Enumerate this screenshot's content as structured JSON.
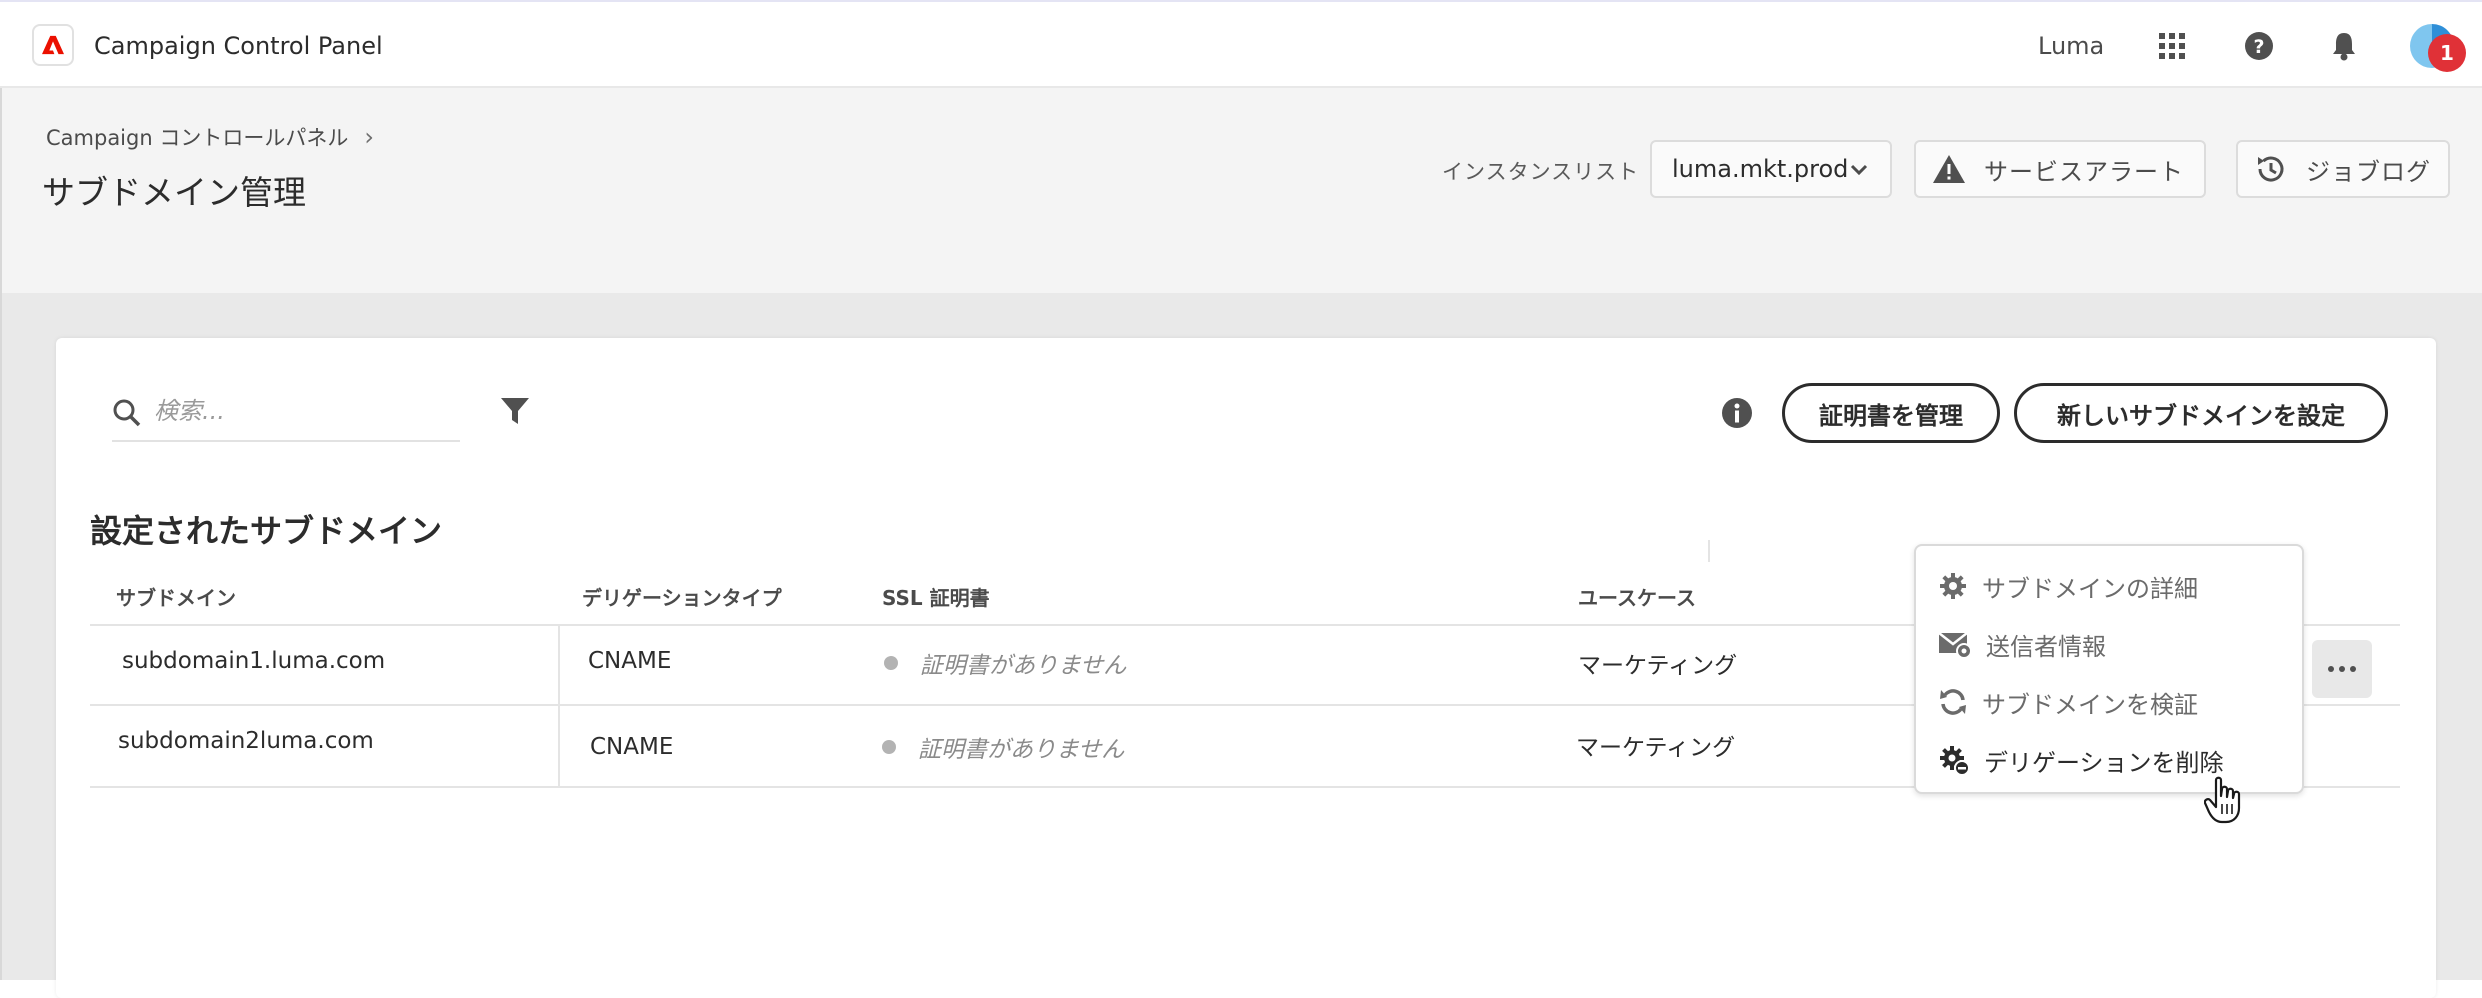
{
  "shell": {
    "app_title": "Campaign Control Panel",
    "org_name": "Luma",
    "icons": [
      "adobe-logo-icon",
      "apps-grid-icon",
      "help-icon",
      "bell-icon",
      "avatar"
    ]
  },
  "header": {
    "breadcrumb": "Campaign コントロールパネル",
    "title": "サブドメイン管理",
    "instance_label": "インスタンスリスト",
    "instance_value": "luma.mkt.prod",
    "service_alert_label": "サービスアラート",
    "job_log_label": "ジョブログ",
    "job_log_badge": "1"
  },
  "toolbar": {
    "search_placeholder": "検索...",
    "manage_certs_label": "証明書を管理",
    "new_subdomain_label": "新しいサブドメインを設定"
  },
  "table": {
    "section_title": "設定されたサブドメイン",
    "columns": [
      "サブドメイン",
      "デリゲーションタイプ",
      "SSL 証明書",
      "ユースケース"
    ],
    "rows": [
      {
        "subdomain": "subdomain1.luma.com",
        "delegation": "CNAME",
        "ssl": "証明書がありません",
        "use_case": "マーケティング"
      },
      {
        "subdomain": "subdomain2luma.com",
        "delegation": "CNAME",
        "ssl": "証明書がありません",
        "use_case": "マーケティング"
      }
    ]
  },
  "menu": {
    "items": [
      "サブドメインの詳細",
      "送信者情報",
      "サブドメインを検証",
      "デリゲーションを削除"
    ]
  },
  "colors": {
    "accent_red": "#e03137",
    "adobe_red": "#eb1000",
    "header_bg": "#f4f4f4",
    "content_bg": "#e9e9e9"
  }
}
